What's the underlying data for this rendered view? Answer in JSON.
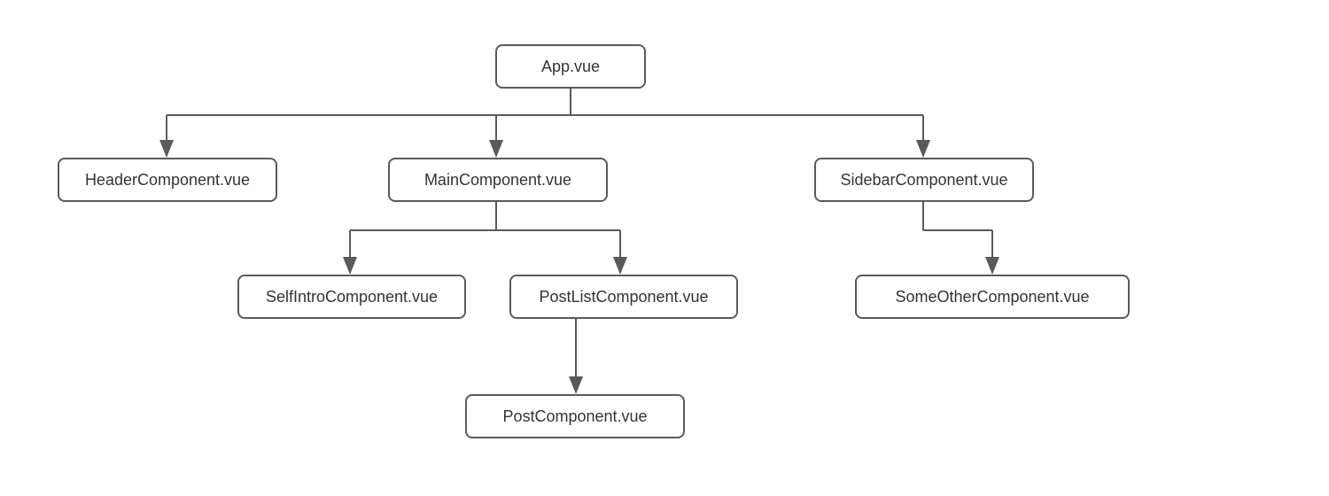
{
  "nodes": {
    "root": "App.vue",
    "header": "HeaderComponent.vue",
    "main": "MainComponent.vue",
    "sidebar": "SidebarComponent.vue",
    "selfintro": "SelfIntroComponent.vue",
    "postlist": "PostListComponent.vue",
    "someother": "SomeOtherComponent.vue",
    "post": "PostComponent.vue"
  },
  "tree": {
    "App.vue": [
      "HeaderComponent.vue",
      "MainComponent.vue",
      "SidebarComponent.vue"
    ],
    "MainComponent.vue": [
      "SelfIntroComponent.vue",
      "PostListComponent.vue"
    ],
    "SidebarComponent.vue": [
      "SomeOtherComponent.vue"
    ],
    "PostListComponent.vue": [
      "PostComponent.vue"
    ]
  }
}
